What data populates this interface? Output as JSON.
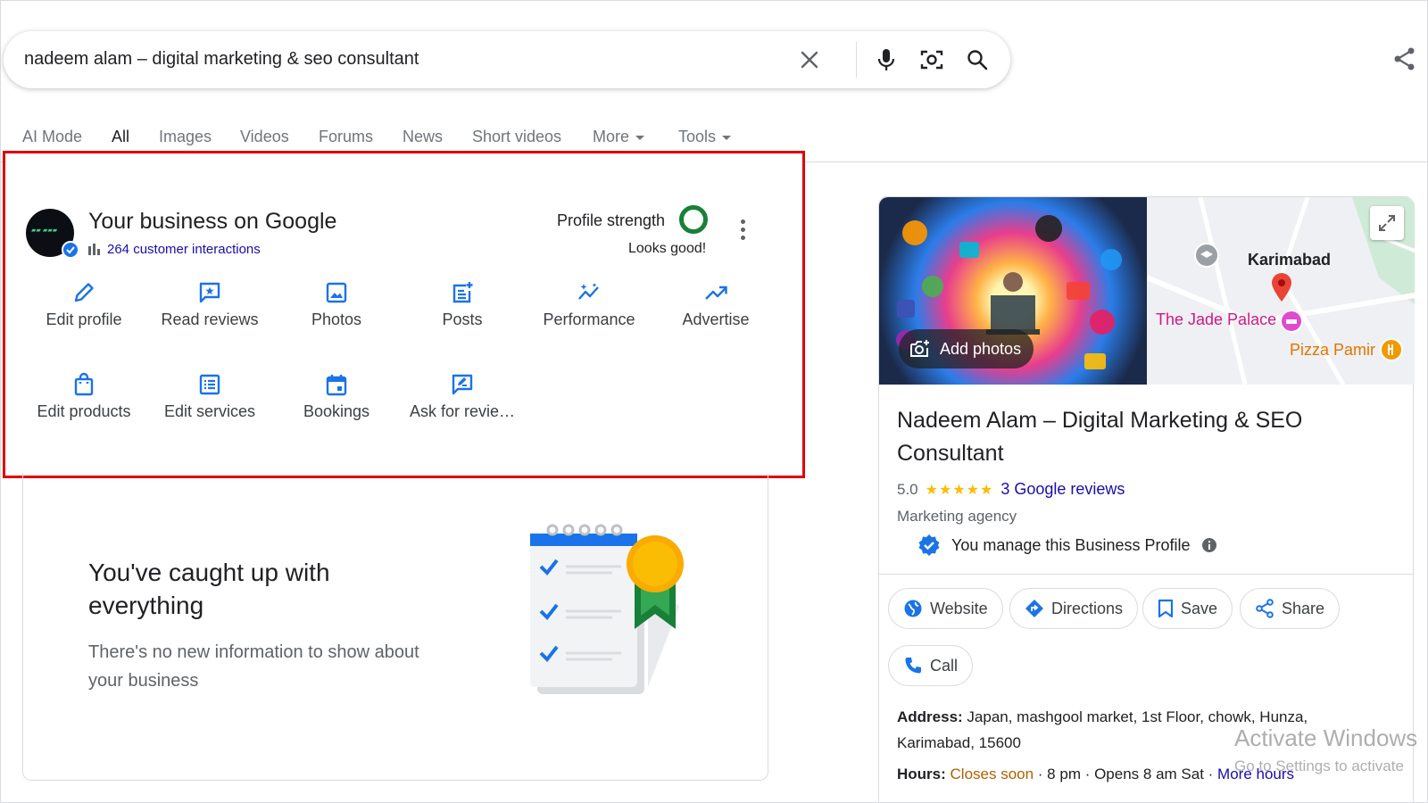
{
  "search": {
    "query": "nadeem alam – digital marketing & seo consultant",
    "icons": [
      "close-icon",
      "mic-icon",
      "lens-icon",
      "search-icon"
    ]
  },
  "tabs": [
    {
      "label": "AI Mode"
    },
    {
      "label": "All",
      "active": true
    },
    {
      "label": "Images"
    },
    {
      "label": "Videos"
    },
    {
      "label": "Forums"
    },
    {
      "label": "News"
    },
    {
      "label": "Short videos"
    },
    {
      "label": "More"
    },
    {
      "label": "Tools"
    }
  ],
  "business": {
    "title": "Your business on Google",
    "interactions": "264 customer interactions",
    "profile_strength_label": "Profile strength",
    "profile_strength_status": "Looks good!",
    "actions": [
      {
        "label": "Edit profile"
      },
      {
        "label": "Read reviews"
      },
      {
        "label": "Photos"
      },
      {
        "label": "Posts"
      },
      {
        "label": "Performance"
      },
      {
        "label": "Advertise"
      },
      {
        "label": "Edit products"
      },
      {
        "label": "Edit services"
      },
      {
        "label": "Bookings"
      },
      {
        "label": "Ask for revie…"
      }
    ]
  },
  "caught_up": {
    "title": "You've caught up with everything",
    "subtitle": "There's no new information to show about your business"
  },
  "knowledge_panel": {
    "add_photos": "Add photos",
    "map": {
      "place": "Karimabad",
      "poi_1": "The Jade Palace",
      "poi_2": "Pizza Pamir"
    },
    "title": "Nadeem Alam – Digital Marketing & SEO Consultant",
    "rating": "5.0",
    "stars": "★★★★★",
    "reviews_link": "3 Google reviews",
    "category": "Marketing agency",
    "manage_text": "You manage this Business Profile",
    "buttons": {
      "website": "Website",
      "directions": "Directions",
      "save": "Save",
      "share": "Share",
      "call": "Call"
    },
    "address_label": "Address:",
    "address": "Japan, mashgool market, 1st Floor, chowk, Hunza, Karimabad, 15600",
    "hours_label": "Hours:",
    "hours_status": "Closes soon",
    "hours_detail": " · 8 pm · Opens 8 am Sat · ",
    "more_hours": "More hours"
  },
  "watermark": {
    "line1": "Activate Windows",
    "line2": "Go to Settings to activate"
  },
  "colors": {
    "accent_blue": "#1a73e8",
    "link_blue": "#1a0dab",
    "highlight_red": "#e00000",
    "strength_green": "#188038",
    "star_yellow": "#fbbc04"
  }
}
